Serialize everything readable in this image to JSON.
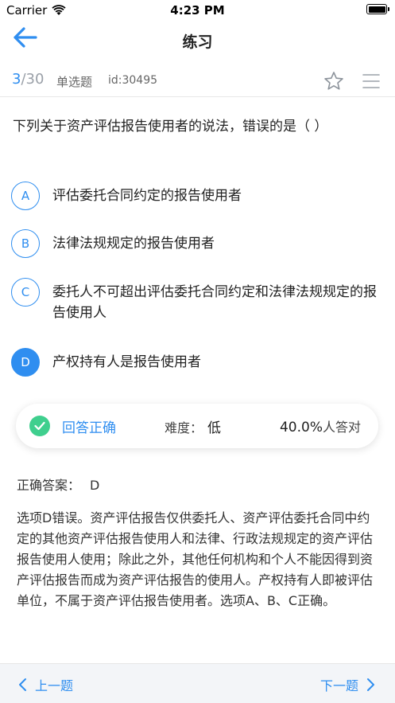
{
  "status": {
    "carrier": "Carrier",
    "time": "4:23 PM"
  },
  "nav": {
    "title": "练习"
  },
  "info": {
    "current": "3",
    "total": "/30",
    "type": "单选题",
    "id": "id:30495"
  },
  "question": {
    "text": "下列关于资产评估报告使用者的说法，错误的是（    ）"
  },
  "options": [
    {
      "letter": "A",
      "text": "评估委托合同约定的报告使用者"
    },
    {
      "letter": "B",
      "text": "法律法规规定的报告使用者"
    },
    {
      "letter": "C",
      "text": "委托人不可超出评估委托合同约定和法律法规规定的报告使用人"
    },
    {
      "letter": "D",
      "text": "产权持有人是报告使用者"
    }
  ],
  "selected_option": "D",
  "result": {
    "status": "回答正确",
    "difficulty_label": "难度：",
    "difficulty_value": "低",
    "rate": "40.0%",
    "rate_suffix": "人答对"
  },
  "answer": {
    "label": "正确答案：",
    "value": "D"
  },
  "analysis": "选项D错误。资产评估报告仅供委托人、资产评估委托合同中约定的其他资产评估报告使用人和法律、行政法规规定的资产评估报告使用人使用；除此之外，其他任何机构和个人不能因得到资产评估报告而成为资产评估报告的使用人。产权持有人即被评估单位，不属于资产评估报告使用者。选项A、B、C正确。",
  "bottom": {
    "prev": "上一题",
    "next": "下一题"
  },
  "colors": {
    "accent": "#2f8ef0",
    "success": "#3fcf8e"
  }
}
